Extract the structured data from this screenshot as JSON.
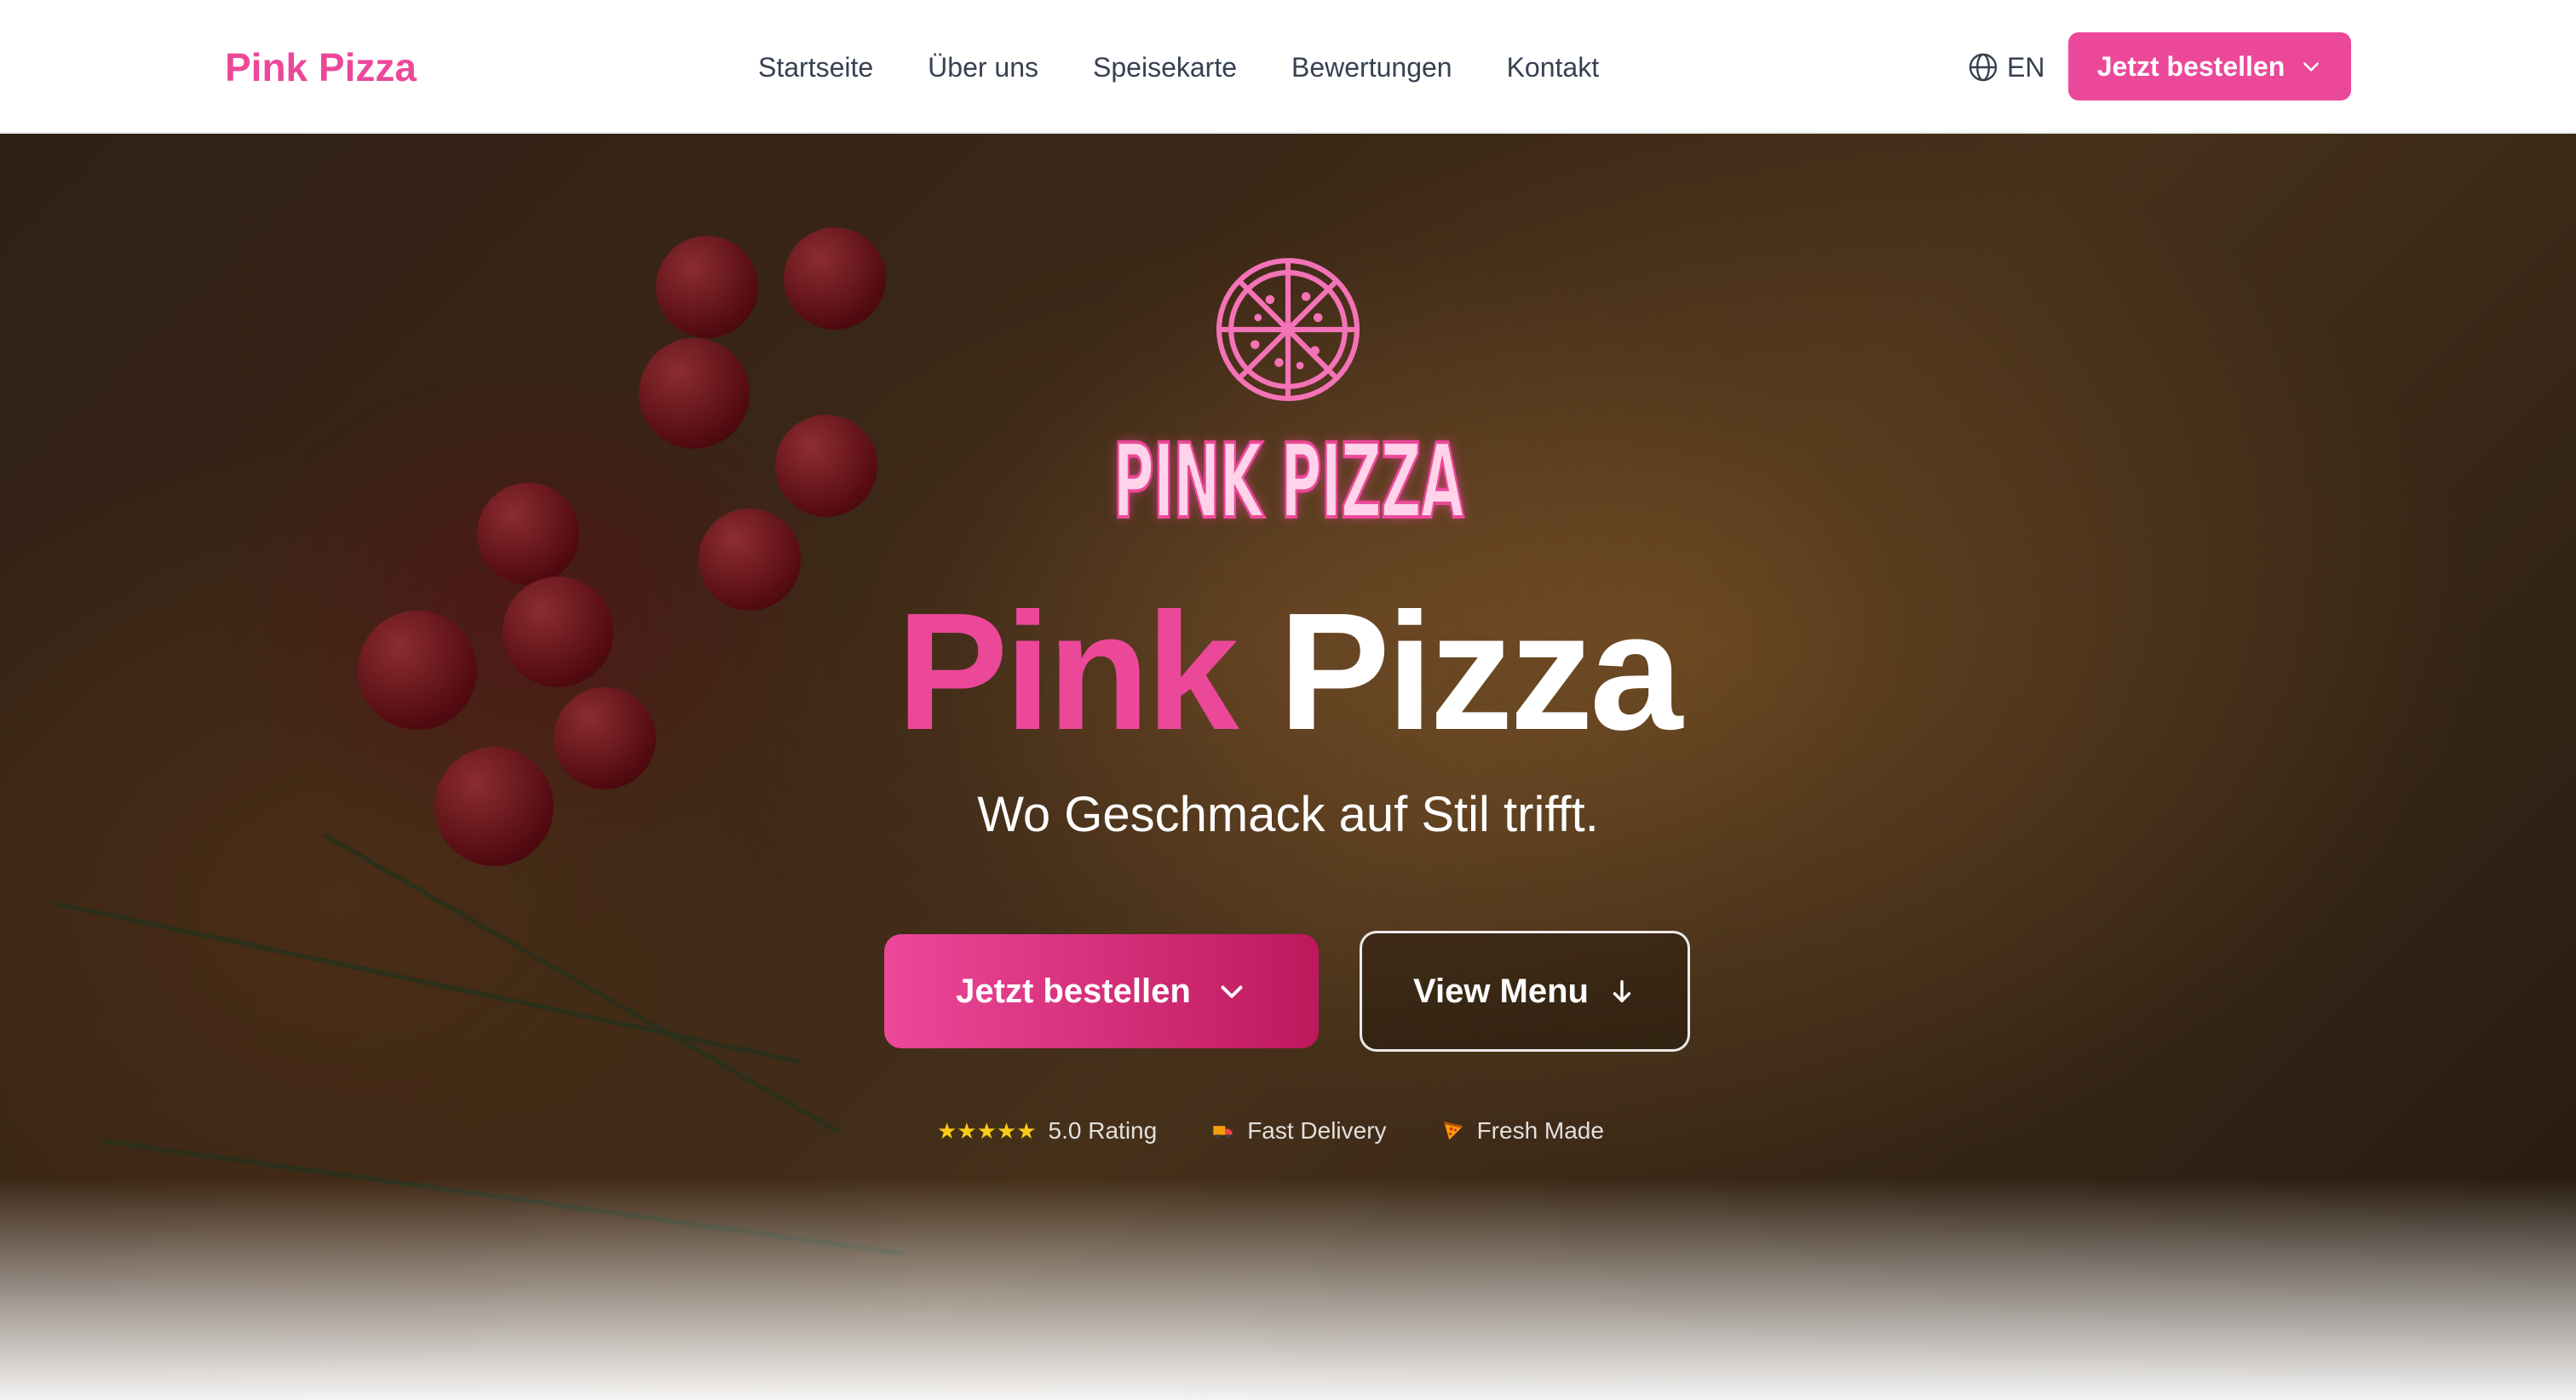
{
  "header": {
    "brand": "Pink Pizza",
    "nav": [
      "Startseite",
      "Über uns",
      "Speisekarte",
      "Bewertungen",
      "Kontakt"
    ],
    "language": "EN",
    "order_button": "Jetzt bestellen"
  },
  "hero": {
    "logo_text": "PINK PIZZA",
    "title_pink": "Pink",
    "title_white": "Pizza",
    "tagline": "Wo Geschmack auf Stil trifft.",
    "order_button": "Jetzt bestellen",
    "menu_button": "View Menu",
    "features": {
      "rating_stars": "★★★★★",
      "rating": "5.0 Rating",
      "delivery": "Fast Delivery",
      "fresh": "Fresh Made"
    }
  },
  "colors": {
    "accent": "#ec4899",
    "accent_dark": "#be185d",
    "text_dark": "#374151",
    "star": "#facc15"
  },
  "icons": [
    "globe-icon",
    "chevron-down-icon",
    "pizza-logo-icon",
    "arrow-down-icon",
    "star-icon",
    "delivery-truck-icon",
    "pizza-slice-icon"
  ]
}
